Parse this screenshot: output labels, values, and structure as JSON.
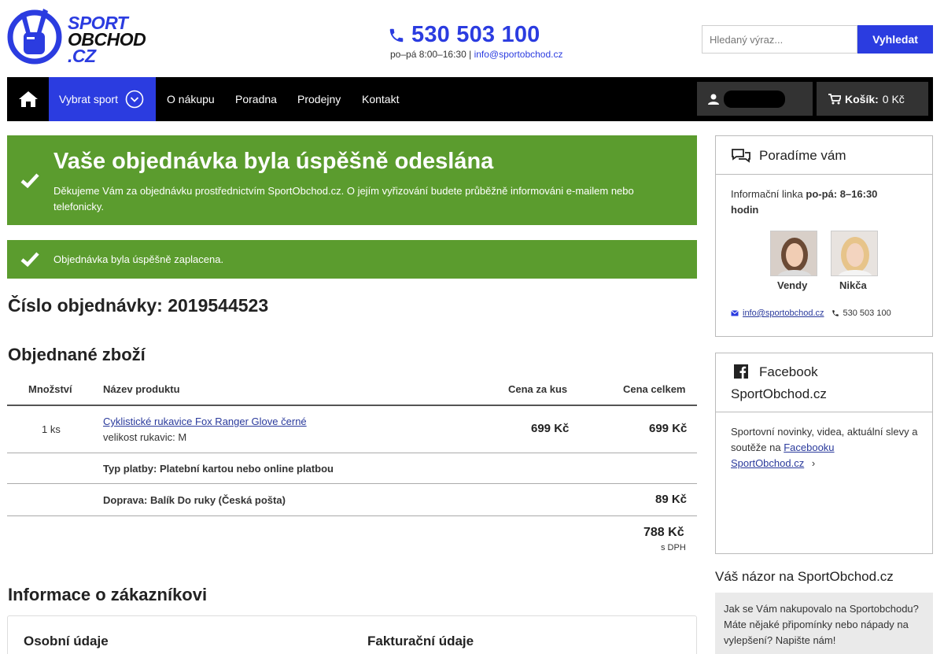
{
  "header": {
    "logo": {
      "line1": "SPORT",
      "line2": "OBCHOD",
      "line3": ".CZ"
    },
    "phone": "530 503 100",
    "hours": "po–pá 8:00–16:30",
    "separator": "|",
    "email": "info@sportobchod.cz",
    "search": {
      "placeholder": "Hledaný výraz...",
      "button": "Vyhledat"
    }
  },
  "nav": {
    "items": [
      "Vybrat sport",
      "O nákupu",
      "Poradna",
      "Prodejny",
      "Kontakt"
    ],
    "cart_label": "Košík:",
    "cart_value": "0 Kč"
  },
  "banners": {
    "success_title": "Vaše objednávka byla úspěšně odeslána",
    "success_text": "Děkujeme Vám za objednávku prostřednictvím SportObchod.cz. O jejím vyřizování budete průběžně informováni e-mailem nebo telefonicky.",
    "paid_text": "Objednávka byla úspěšně zaplacena."
  },
  "order": {
    "number_label": "Číslo objednávky: 2019544523",
    "goods_title": "Objednané zboží",
    "columns": [
      "Množství",
      "Název produktu",
      "Cena za kus",
      "Cena celkem"
    ],
    "items": [
      {
        "qty": "1 ks",
        "name": "Cyklistické rukavice Fox Ranger Glove černé",
        "variant": "velikost rukavic: M",
        "unit_price": "699 Kč",
        "total": "699 Kč"
      }
    ],
    "payment": "Typ platby: Platební kartou nebo online platbou",
    "shipping_label": "Doprava: Balík Do ruky (Česká pošta)",
    "shipping_price": "89 Kč",
    "grand_total": "788 Kč",
    "vat_note": "s DPH"
  },
  "customer": {
    "title": "Informace o zákazníkovi",
    "col_personal": "Osobní údaje",
    "col_billing": "Fakturační údaje"
  },
  "sidebar": {
    "advice": {
      "title": "Poradíme vám",
      "line_prefix": "Informační linka ",
      "line_bold": "po-pá: 8–16:30 hodin",
      "agents": [
        "Vendy",
        "Nikča"
      ],
      "email": "info@sportobchod.cz",
      "phone": "530 503 100"
    },
    "facebook": {
      "title_line1": "Facebook",
      "title_line2": "SportObchod.cz",
      "text": "Sportovní novinky, videa, aktuální slevy a soutěže na ",
      "link1": "Facebooku",
      "link2": "SportObchod.cz",
      "arrow": "›"
    },
    "opinion": {
      "title": "Váš názor na SportObchod.cz",
      "text": "Jak se Vám nakupovalo na Sportobchodu? Máte nějaké připomínky nebo nápady na vylepšení? Napište nám!"
    }
  },
  "colors": {
    "brand_blue": "#2b3ce0",
    "success_green": "#5b9c2e",
    "nav_black": "#000000"
  },
  "icons": [
    "logo-peace-hand-icon",
    "phone-icon",
    "home-icon",
    "chevron-down-circle-icon",
    "user-icon",
    "cart-icon",
    "checkmark-icon",
    "chat-bubbles-icon",
    "facebook-icon",
    "envelope-icon",
    "phone-small-icon"
  ]
}
